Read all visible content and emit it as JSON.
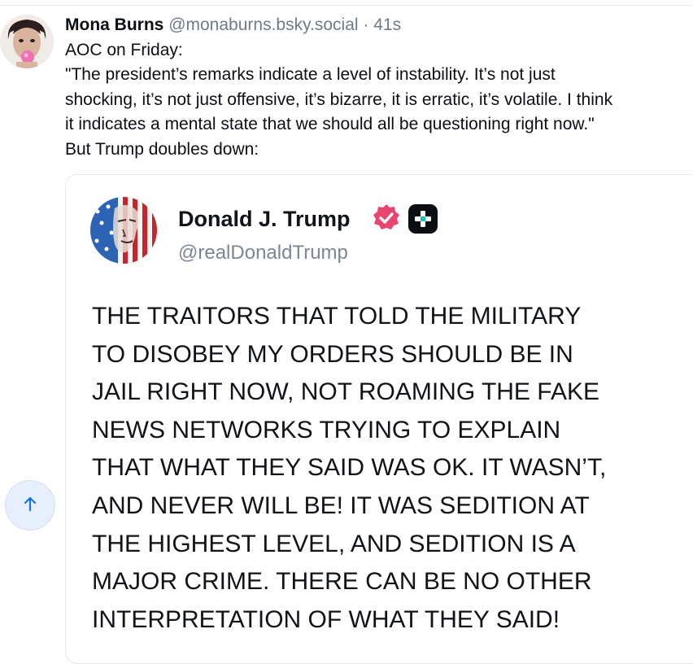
{
  "post": {
    "author_name": "Mona Burns",
    "author_handle": "@monaburns.bsky.social",
    "separator": "·",
    "age": "41s",
    "text_lines": [
      "AOC on Friday:",
      "\"The president’s remarks indicate a level of instability. It’s not just",
      "shocking, it’s not just offensive, it’s bizarre, it is erratic, it’s volatile. I think",
      "it indicates a mental state that we should all be questioning right now.\"",
      "But Trump doubles down:"
    ]
  },
  "embed": {
    "display_name": "Donald J. Trump",
    "handle": "@realDonaldTrump",
    "body_lines": [
      "THE TRAITORS THAT TOLD THE MILITARY",
      "TO DISOBEY MY ORDERS SHOULD BE IN",
      "JAIL RIGHT NOW, NOT ROAMING THE FAKE",
      "NEWS NETWORKS TRYING TO EXPLAIN",
      "THAT WHAT THEY SAID WAS OK. IT WASN’T,",
      "AND NEVER WILL BE! IT WAS SEDITION AT",
      "THE HIGHEST LEVEL, AND SEDITION IS A",
      "MAJOR CRIME. THERE CAN BE NO OTHER",
      "INTERPRETATION OF WHAT THEY SAID!"
    ]
  },
  "icons": {
    "verified": "verified-badge-icon",
    "plus": "plus-badge-icon",
    "scroll_top": "arrow-up-icon"
  },
  "colors": {
    "verified": "#e8456f",
    "handle_gray": "#6f7b89",
    "scroll_button_bg": "#e7eefc",
    "scroll_arrow": "#1a73e8"
  }
}
